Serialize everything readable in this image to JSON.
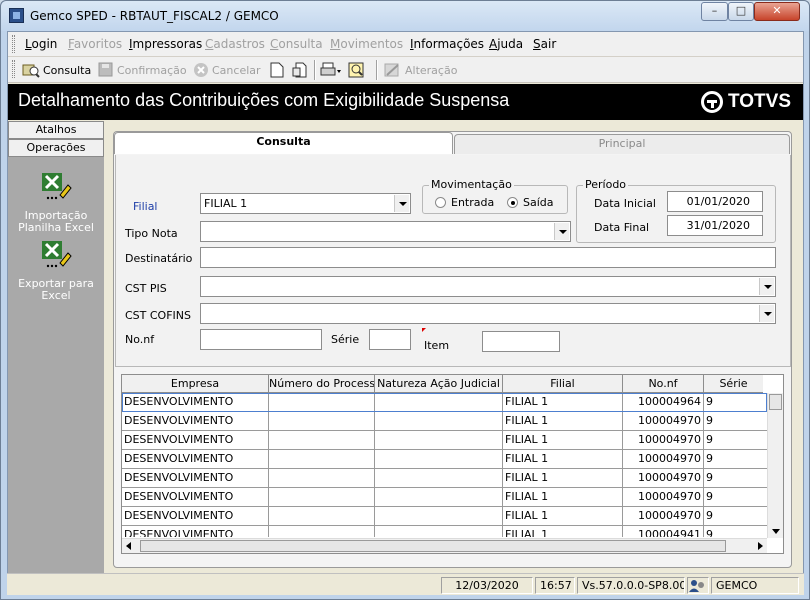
{
  "window": {
    "title": "Gemco SPED - RBTAUT_FISCAL2 / GEMCO",
    "minimize_label": "–",
    "maximize_label": "□",
    "close_label": "✕"
  },
  "menu": {
    "items": [
      {
        "label": "Login",
        "enabled": true
      },
      {
        "label": "Favoritos",
        "enabled": false
      },
      {
        "label": "Impressoras",
        "enabled": true
      },
      {
        "label": "Cadastros",
        "enabled": false
      },
      {
        "label": "Consulta",
        "enabled": false
      },
      {
        "label": "Movimentos",
        "enabled": false
      },
      {
        "label": "Informações",
        "enabled": true
      },
      {
        "label": "Ajuda",
        "enabled": true
      },
      {
        "label": "Sair",
        "enabled": true
      }
    ]
  },
  "toolbar": {
    "consulta_label": "Consulta",
    "confirmacao_label": "Confirmação",
    "cancelar_label": "Cancelar",
    "alteracao_label": "Alteração"
  },
  "header": {
    "title": "Detalhamento das Contribuições com Exigibilidade Suspensa",
    "logo_text": "TOTVS"
  },
  "sidebar": {
    "tabs": [
      "Atalhos",
      "Operações"
    ],
    "actions": [
      {
        "label": "Importação Planilha Excel",
        "icon": "excel-import-icon"
      },
      {
        "label": "Exportar para Excel",
        "icon": "excel-export-icon"
      }
    ]
  },
  "tabs": {
    "consulta": "Consulta",
    "principal": "Principal"
  },
  "form": {
    "filial_label": "Filial",
    "filial_value": "FILIAL 1",
    "tipo_nota_label": "Tipo Nota",
    "destinatario_label": "Destinatário",
    "cst_pis_label": "CST PIS",
    "cst_cofins_label": "CST COFINS",
    "nonf_label": "No.nf",
    "serie_label": "Série",
    "item_label": "Item",
    "movimentacao": {
      "title": "Movimentação",
      "options": [
        "Entrada",
        "Saída"
      ],
      "selected": "Saída"
    },
    "periodo": {
      "title": "Período",
      "data_inicial_label": "Data Inicial",
      "data_inicial": "01/01/2020",
      "data_final_label": "Data Final",
      "data_final": "31/01/2020"
    }
  },
  "grid": {
    "columns": [
      "Empresa",
      "Número do Processo",
      "Natureza Ação Judicial",
      "Filial",
      "No.nf",
      "Série"
    ],
    "rows": [
      [
        "DESENVOLVIMENTO",
        "",
        "",
        "FILIAL 1",
        "100004964",
        "9"
      ],
      [
        "DESENVOLVIMENTO",
        "",
        "",
        "FILIAL 1",
        "100004970",
        "9"
      ],
      [
        "DESENVOLVIMENTO",
        "",
        "",
        "FILIAL 1",
        "100004970",
        "9"
      ],
      [
        "DESENVOLVIMENTO",
        "",
        "",
        "FILIAL 1",
        "100004970",
        "9"
      ],
      [
        "DESENVOLVIMENTO",
        "",
        "",
        "FILIAL 1",
        "100004970",
        "9"
      ],
      [
        "DESENVOLVIMENTO",
        "",
        "",
        "FILIAL 1",
        "100004970",
        "9"
      ],
      [
        "DESENVOLVIMENTO",
        "",
        "",
        "FILIAL 1",
        "100004970",
        "9"
      ],
      [
        "DESENVOLVIMENTO",
        "",
        "",
        "FILIAL 1",
        "100004941",
        "9"
      ]
    ]
  },
  "status": {
    "date": "12/03/2020",
    "time": "16:57",
    "version": "Vs.57.0.0.0-SP8.00.8",
    "company": "GEMCO"
  }
}
